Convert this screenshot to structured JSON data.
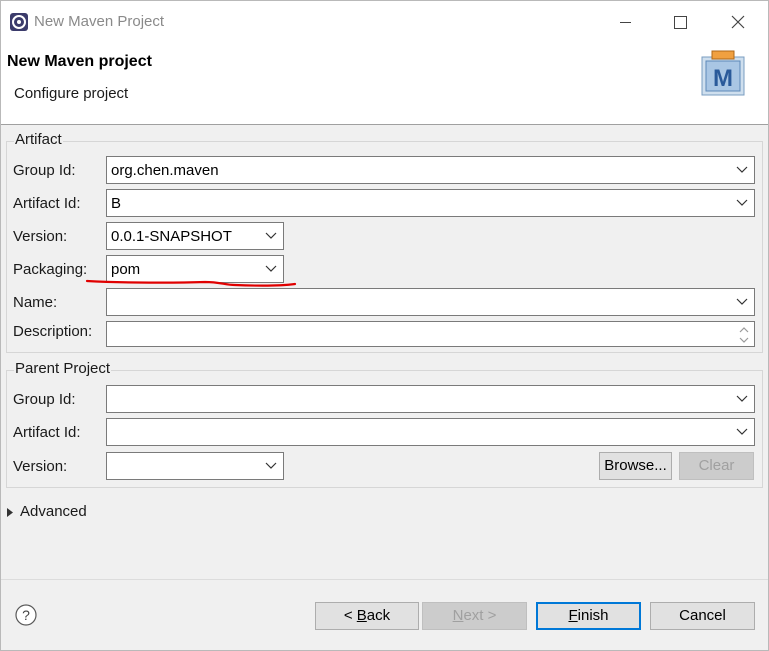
{
  "window": {
    "title": "New Maven Project",
    "controls": {
      "minimize": "minimize-icon",
      "maximize": "maximize-icon",
      "close": "close-icon"
    }
  },
  "header": {
    "title": "New Maven project",
    "subtitle": "Configure project",
    "logo_letter": "M"
  },
  "artifact": {
    "legend": "Artifact",
    "group_id": {
      "label": "Group Id:",
      "value": "org.chen.maven"
    },
    "artifact_id": {
      "label": "Artifact Id:",
      "value": "B"
    },
    "version": {
      "label": "Version:",
      "value": "0.0.1-SNAPSHOT"
    },
    "packaging": {
      "label": "Packaging:",
      "value": "pom"
    },
    "name": {
      "label": "Name:",
      "value": ""
    },
    "description": {
      "label": "Description:",
      "value": ""
    }
  },
  "parent": {
    "legend": "Parent Project",
    "group_id": {
      "label": "Group Id:",
      "value": ""
    },
    "artifact_id": {
      "label": "Artifact Id:",
      "value": ""
    },
    "version": {
      "label": "Version:",
      "value": ""
    },
    "browse_label": "Browse...",
    "clear_label": "Clear"
  },
  "advanced": {
    "label": "Advanced",
    "icon": "expand-triangle-icon"
  },
  "footer": {
    "help_icon": "help-icon",
    "back": {
      "prefix": "< ",
      "mnemonic": "B",
      "rest": "ack",
      "enabled": true
    },
    "next": {
      "mnemonic": "N",
      "rest": "ext >",
      "enabled": false
    },
    "finish": {
      "mnemonic": "F",
      "rest": "inish",
      "enabled": true
    },
    "cancel": {
      "label": "Cancel",
      "enabled": true
    }
  },
  "colors": {
    "annotation": "#e00000",
    "default_button_border": "#0078d7",
    "disabled_text": "#a0a0a0"
  }
}
